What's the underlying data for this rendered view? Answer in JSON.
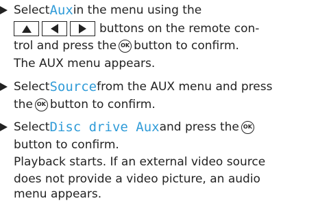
{
  "step1": {
    "line1_pre": "Select ",
    "line1_kw": "Aux",
    "line1_post": " in the menu using the",
    "line2_post": "buttons on the remote con-",
    "line3_pre": "trol and press the ",
    "ok": "OK",
    "line3_post": " button to confirm.",
    "line4": "The AUX menu appears."
  },
  "step2": {
    "line1_pre": "Select ",
    "line1_kw": "Source",
    "line1_post": " from the AUX menu and press",
    "line2_pre": "the ",
    "ok": "OK",
    "line2_post": " button to confirm."
  },
  "step3": {
    "line1_pre": "Select ",
    "line1_kw": "Disc drive Aux",
    "line1_post": " and press the ",
    "ok": "OK",
    "line2": "button to confirm.",
    "line3": "Playback starts. If an external video source",
    "line4": "does not provide a video picture, an audio",
    "line5": "menu appears."
  }
}
